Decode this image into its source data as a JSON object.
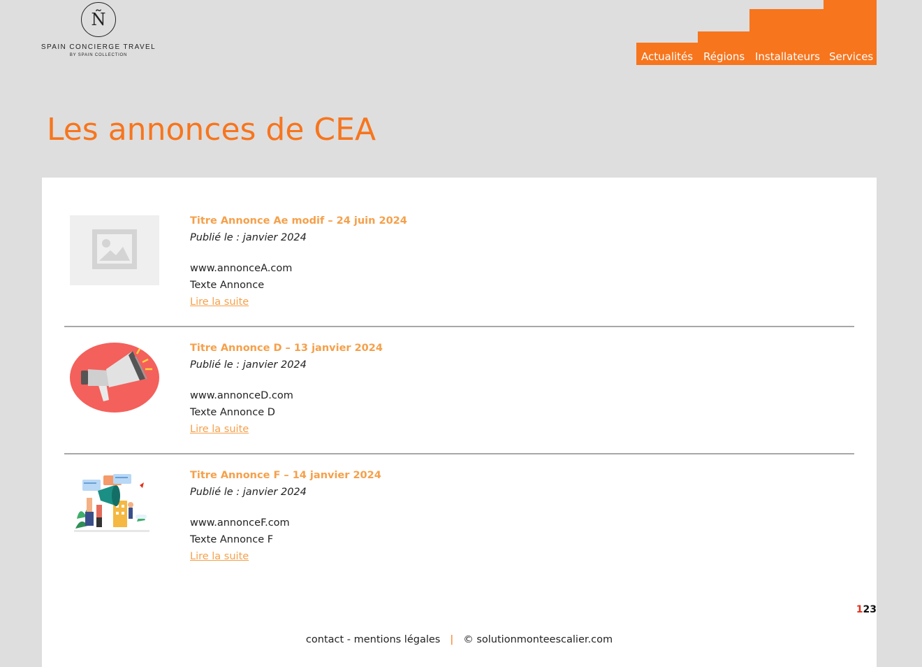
{
  "logo": {
    "mark": "Ñ",
    "name": "SPAIN CONCIERGE TRAVEL",
    "tagline": "BY SPAIN COLLECTION"
  },
  "nav": {
    "items": [
      {
        "label": "Actualités"
      },
      {
        "label": "Régions"
      },
      {
        "label": "Installateurs"
      },
      {
        "label": "Services"
      }
    ]
  },
  "page": {
    "title": "Les annonces de CEA"
  },
  "annonces": [
    {
      "title": "Titre Annonce Ae modif – 24 juin 2024",
      "published": "Publié le : janvier 2024",
      "url": "www.annonceA.com",
      "text": "Texte Annonce",
      "read_more": "Lire la suite",
      "image": "placeholder-image-icon"
    },
    {
      "title": "Titre Annonce D – 13 janvier 2024",
      "published": "Publié le : janvier 2024",
      "url": "www.annonceD.com",
      "text": "Texte Annonce D",
      "read_more": "Lire la suite",
      "image": "megaphone-icon"
    },
    {
      "title": "Titre Annonce F – 14 janvier 2024",
      "published": "Publié le : janvier 2024",
      "url": "www.annonceF.com",
      "text": "Texte Annonce F",
      "read_more": "Lire la suite",
      "image": "marketing-illustration"
    }
  ],
  "pagination": {
    "pages": [
      "1",
      "2",
      "3"
    ],
    "current": "1"
  },
  "footer": {
    "contact": "contact",
    "dash": " - ",
    "legal": "mentions légales",
    "separator": "|",
    "copyright": "© solutionmonteescalier.com"
  },
  "colors": {
    "accent": "#f7751d",
    "link": "#f5a04a",
    "background": "#dedede"
  }
}
